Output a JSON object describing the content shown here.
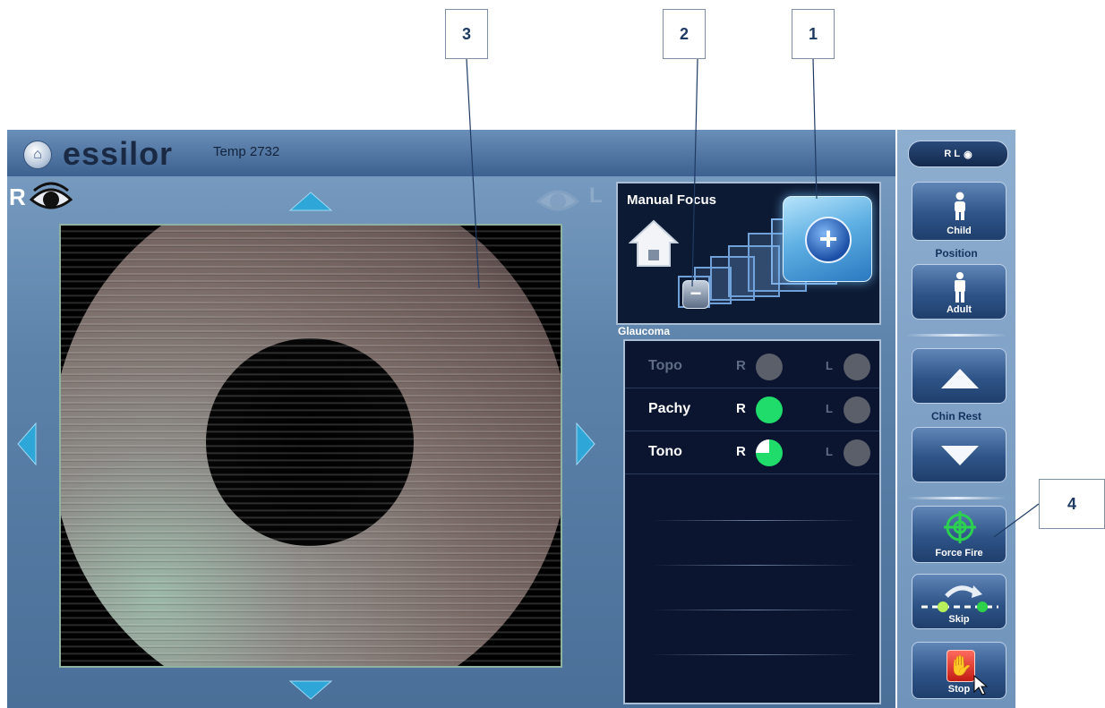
{
  "callouts": [
    "3",
    "2",
    "1",
    "4"
  ],
  "header": {
    "brand": "essilor",
    "patient": "Temp 2732",
    "home_icon": "house-icon"
  },
  "eyes": {
    "right_label": "R",
    "left_label": "L"
  },
  "manual_focus": {
    "title": "Manual Focus"
  },
  "glaucoma": {
    "title": "Glaucoma",
    "rows": [
      {
        "name": "Topo",
        "r": "R",
        "l": "L",
        "r_status": "pending",
        "l_status": "pending"
      },
      {
        "name": "Pachy",
        "r": "R",
        "l": "L",
        "r_status": "done",
        "l_status": "pending"
      },
      {
        "name": "Tono",
        "r": "R",
        "l": "L",
        "r_status": "partial",
        "l_status": "pending"
      }
    ],
    "tono_progress": 0.75
  },
  "side": {
    "eye_toggle": "R L",
    "child": "Child",
    "position": "Position",
    "adult": "Adult",
    "chin_rest": "Chin Rest",
    "force_fire": "Force Fire",
    "skip": "Skip",
    "stop": "Stop"
  },
  "colors": {
    "done": "#1fdc6b",
    "pending": "#5a5f69",
    "accent": "#3d6190"
  }
}
